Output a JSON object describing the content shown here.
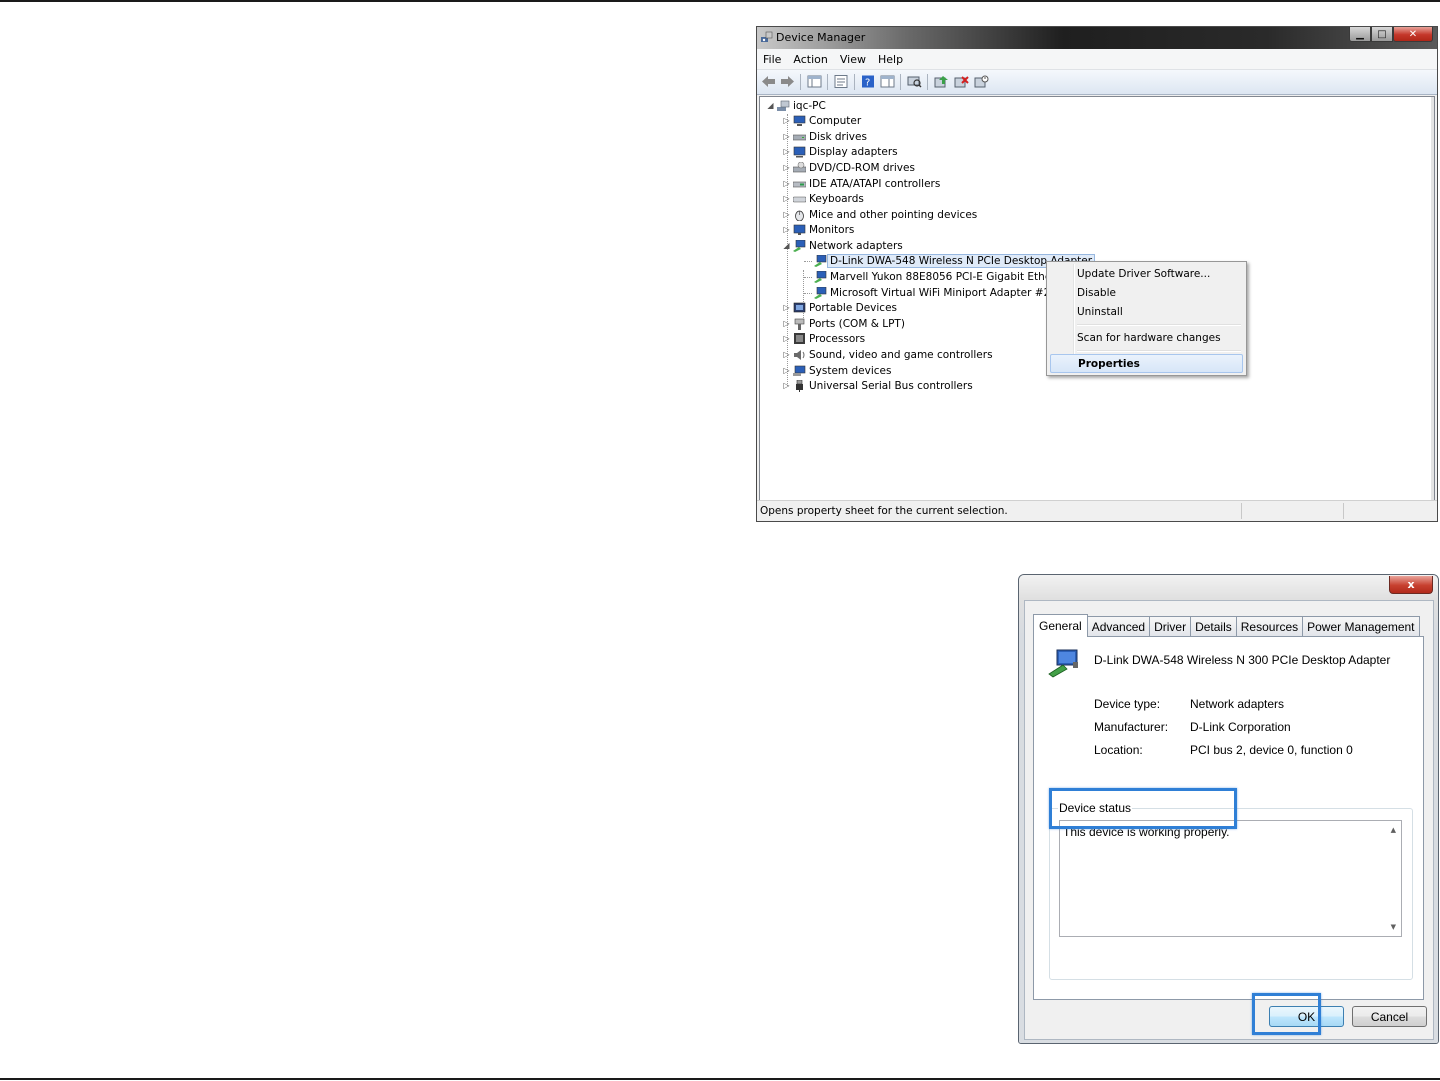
{
  "device_manager": {
    "title": "Device Manager",
    "menu": [
      "File",
      "Action",
      "View",
      "Help"
    ],
    "toolbar_icons": [
      "back-icon",
      "forward-icon",
      "show-hide-console-tree-icon",
      "properties-icon",
      "help-icon",
      "action-pane-icon",
      "scan-hardware-icon",
      "update-driver-icon",
      "uninstall-icon",
      "disable-icon"
    ],
    "tree": {
      "root": "iqc-PC",
      "categories": [
        {
          "label": "Computer",
          "icon": "computer-icon"
        },
        {
          "label": "Disk drives",
          "icon": "disk-drive-icon"
        },
        {
          "label": "Display adapters",
          "icon": "display-adapter-icon"
        },
        {
          "label": "DVD/CD-ROM drives",
          "icon": "dvd-drive-icon"
        },
        {
          "label": "IDE ATA/ATAPI controllers",
          "icon": "ide-controller-icon"
        },
        {
          "label": "Keyboards",
          "icon": "keyboard-icon"
        },
        {
          "label": "Mice and other pointing devices",
          "icon": "mouse-icon"
        },
        {
          "label": "Monitors",
          "icon": "monitor-icon"
        },
        {
          "label": "Network adapters",
          "icon": "network-adapter-icon",
          "expanded": true,
          "children": [
            {
              "label": "D-Link DWA-548 Wireless N PCIe Desktop Adapter",
              "selected": true
            },
            {
              "label": "Marvell Yukon 88E8056 PCI-E Gigabit Ethernet C"
            },
            {
              "label": "Microsoft Virtual WiFi Miniport Adapter #2"
            }
          ]
        },
        {
          "label": "Portable Devices",
          "icon": "portable-device-icon"
        },
        {
          "label": "Ports (COM & LPT)",
          "icon": "port-icon"
        },
        {
          "label": "Processors",
          "icon": "processor-icon"
        },
        {
          "label": "Sound, video and game controllers",
          "icon": "speaker-icon"
        },
        {
          "label": "System devices",
          "icon": "system-device-icon"
        },
        {
          "label": "Universal Serial Bus controllers",
          "icon": "usb-icon"
        }
      ]
    },
    "status_bar": "Opens property sheet for the current selection.",
    "context_menu": {
      "items": [
        "Update Driver Software...",
        "Disable",
        "Uninstall",
        "Scan for hardware changes",
        "Properties"
      ],
      "highlighted": "Properties"
    }
  },
  "properties_dialog": {
    "close_label": "x",
    "tabs": [
      "General",
      "Advanced",
      "Driver",
      "Details",
      "Resources",
      "Power Management"
    ],
    "active_tab": "General",
    "device_name": "D-Link DWA-548 Wireless N 300 PCIe Desktop Adapter",
    "fields": [
      {
        "label": "Device type:",
        "value": "Network adapters"
      },
      {
        "label": "Manufacturer:",
        "value": "D-Link Corporation"
      },
      {
        "label": "Location:",
        "value": "PCI bus 2, device 0, function 0"
      }
    ],
    "device_status_label": "Device status",
    "device_status_text": "This device is working properly.",
    "ok_label": "OK",
    "cancel_label": "Cancel"
  },
  "colors": {
    "highlight_box": "#2f7fd6",
    "selection": "#dfeaf8",
    "close_button": "#c7402f"
  }
}
